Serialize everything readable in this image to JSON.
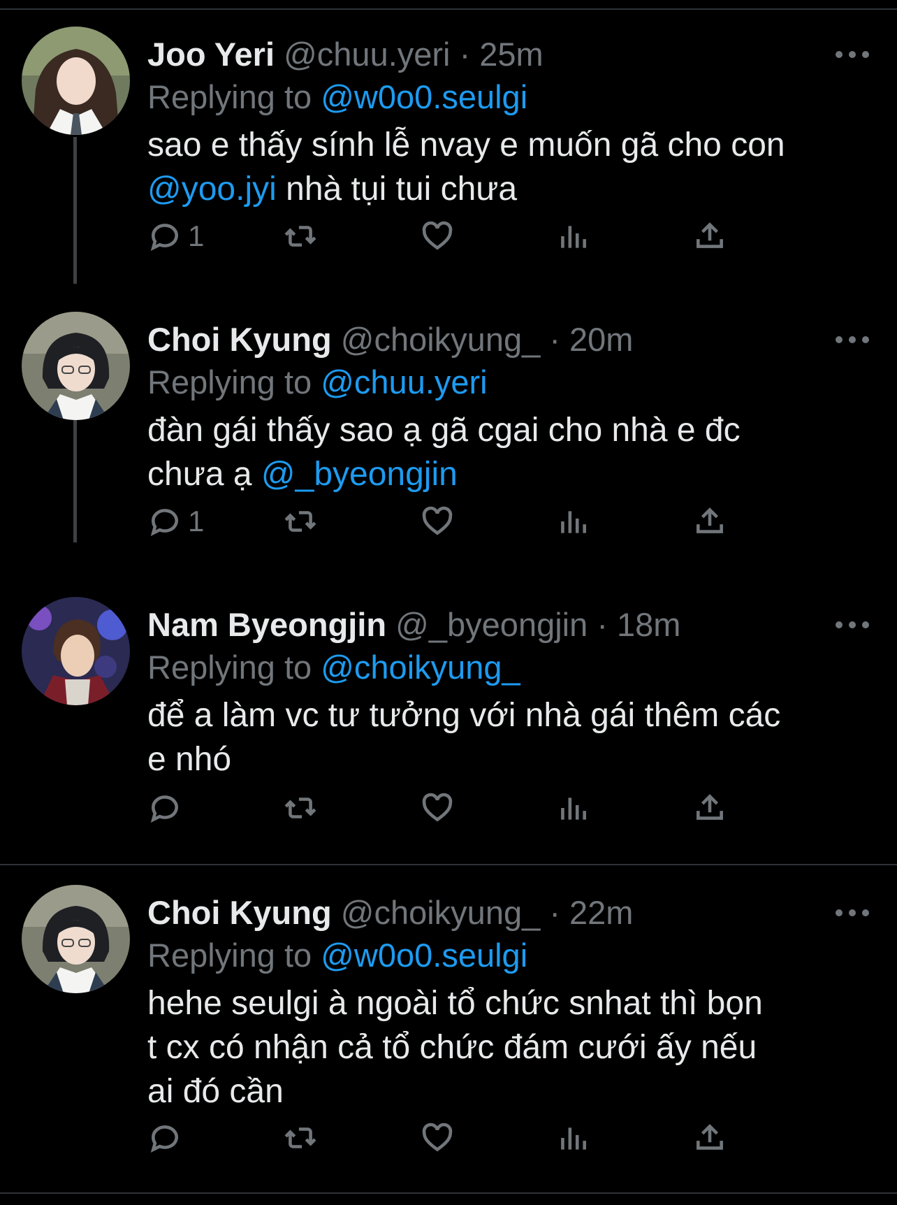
{
  "tweets": [
    {
      "name": "Joo Yeri",
      "handle": "@chuu.yeri",
      "separator": "·",
      "time": "25m",
      "replying_label": "Replying to",
      "replying_to": "@w0o0.seulgi",
      "text_line1": "sao e thấy sính lễ nvay e muốn gã cho con",
      "text_mention": "@yoo.jyi",
      "text_line2_rest": " nhà tụi tui chưa",
      "reply_count": "1",
      "avatar_icon": "avatar-photo"
    },
    {
      "name": "Choi Kyung",
      "handle": "@choikyung_",
      "separator": "·",
      "time": "20m",
      "replying_label": "Replying to",
      "replying_to": "@chuu.yeri",
      "text_line1": "đàn gái thấy sao ạ gã cgai cho nhà e đc",
      "text_line2_start": "chưa ạ ",
      "text_mention": "@_byeongjin",
      "reply_count": "1",
      "avatar_icon": "avatar-photo"
    },
    {
      "name": "Nam Byeongjin",
      "handle": "@_byeongjin",
      "separator": "·",
      "time": "18m",
      "replying_label": "Replying to",
      "replying_to": "@choikyung_",
      "text_line1": "để a làm vc tư tưởng với nhà gái thêm các",
      "text_line2": "e nhó",
      "reply_count": "",
      "avatar_icon": "avatar-photo"
    },
    {
      "name": "Choi Kyung",
      "handle": "@choikyung_",
      "separator": "·",
      "time": "22m",
      "replying_label": "Replying to",
      "replying_to": "@w0o0.seulgi",
      "text_line1": "hehe seulgi à ngoài tổ chức snhat thì bọn",
      "text_line2": "t cx có nhận cả tổ chức đám cưới ấy nếu",
      "text_line3": "ai đó cần",
      "reply_count": "",
      "avatar_icon": "avatar-photo"
    }
  ],
  "colors": {
    "background": "#000000",
    "text": "#e7e9ea",
    "muted": "#71767b",
    "link": "#1d9bf0",
    "divider": "#2f3336"
  },
  "icons": [
    "reply-icon",
    "retweet-icon",
    "like-icon",
    "views-icon",
    "share-icon",
    "more-icon"
  ]
}
